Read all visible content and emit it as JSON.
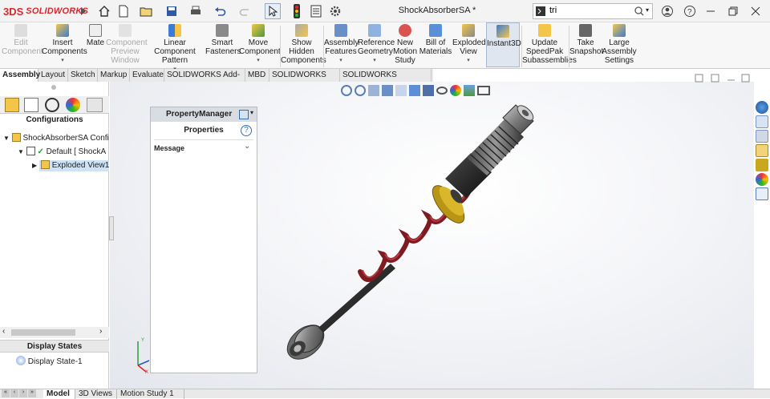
{
  "app": {
    "logo_mark": "3DS",
    "logo_word": "SOLIDWORKS",
    "document_title": "ShockAbsorberSA *"
  },
  "search": {
    "value": "tri",
    "placeholder": ""
  },
  "window_controls": [
    "minimize",
    "restore",
    "close"
  ],
  "ribbon": {
    "buttons": [
      {
        "label": "Edit Component",
        "disabled": true,
        "icon": "edit-component-icon"
      },
      {
        "label": "Insert Components",
        "disabled": false,
        "icon": "insert-components-icon",
        "caret": true
      },
      {
        "label": "Mate",
        "disabled": false,
        "icon": "mate-icon"
      },
      {
        "label": "Component Preview Window",
        "disabled": true,
        "icon": "component-preview-icon"
      },
      {
        "label": "Linear Component Pattern",
        "disabled": false,
        "icon": "linear-pattern-icon",
        "caret": true
      },
      {
        "label": "Smart Fasteners",
        "disabled": false,
        "icon": "smart-fasteners-icon"
      },
      {
        "label": "Move Component",
        "disabled": false,
        "icon": "move-component-icon",
        "caret": true
      },
      {
        "label": "Show Hidden Components",
        "disabled": false,
        "icon": "show-hidden-icon"
      },
      {
        "label": "Assembly Features",
        "disabled": false,
        "icon": "assembly-features-icon",
        "caret": true
      },
      {
        "label": "Reference Geometry",
        "disabled": false,
        "icon": "reference-geometry-icon",
        "caret": true
      },
      {
        "label": "New Motion Study",
        "disabled": false,
        "icon": "motion-study-icon"
      },
      {
        "label": "Bill of Materials",
        "disabled": false,
        "icon": "bom-icon"
      },
      {
        "label": "Exploded View",
        "disabled": false,
        "icon": "exploded-view-icon",
        "caret": true
      },
      {
        "label": "Instant3D",
        "disabled": false,
        "icon": "instant3d-icon",
        "active": true
      },
      {
        "label": "Update SpeedPak Subassemblies",
        "disabled": false,
        "icon": "speedpak-icon"
      },
      {
        "label": "Take Snapshot",
        "disabled": false,
        "icon": "snapshot-icon"
      },
      {
        "label": "Large Assembly Settings",
        "disabled": false,
        "icon": "large-assembly-icon"
      }
    ]
  },
  "tabs": [
    "Assembly",
    "Layout",
    "Sketch",
    "Markup",
    "Evaluate",
    "SOLIDWORKS Add-Ins",
    "MBD",
    "SOLIDWORKS CAM",
    "SOLIDWORKS Inspection"
  ],
  "left_panel": {
    "section_title": "Configurations",
    "tree": [
      {
        "label": "ShockAbsorberSA Confi",
        "level": 0
      },
      {
        "label": "Default [ ShockA",
        "level": 1
      },
      {
        "label": "Exploded View1",
        "level": 2,
        "selected": true
      }
    ],
    "display_states_title": "Display States",
    "display_state": "Display State-1"
  },
  "property_manager": {
    "header": "PropertyManager",
    "title": "Properties",
    "section": "Message"
  },
  "bottom_tabs": [
    "Model",
    "3D Views",
    "Motion Study 1"
  ],
  "colors": {
    "spring": "#8a1c22",
    "washer": "#c9a820",
    "rod": "#1a1a1a",
    "brand": "#d7282f"
  }
}
